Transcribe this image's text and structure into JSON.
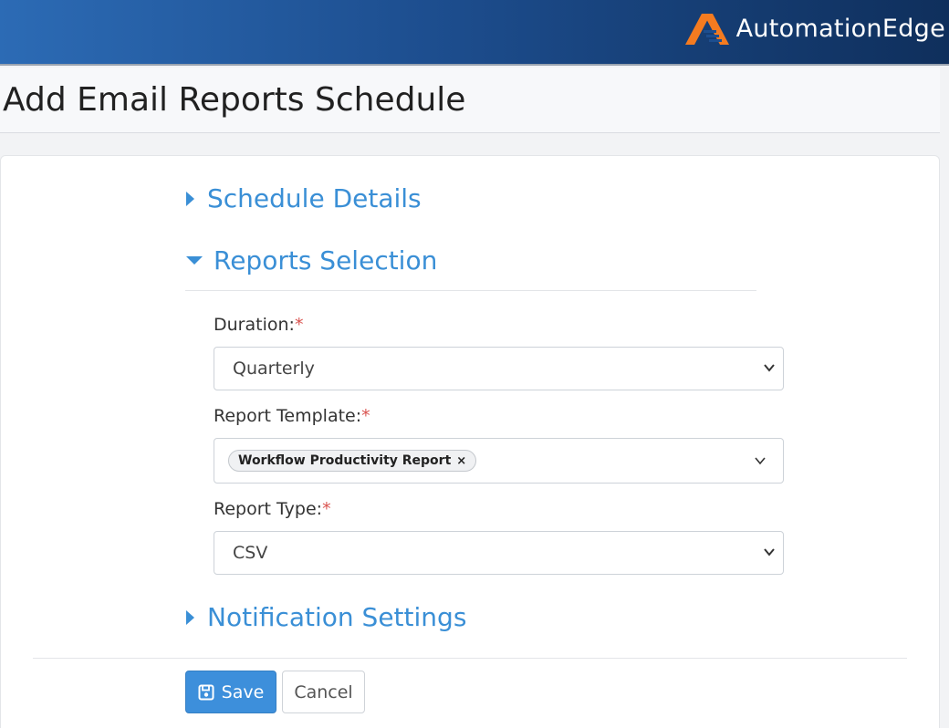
{
  "header": {
    "brand_name": "AutomationEdge",
    "logo_icon": "automationedge-logo-icon"
  },
  "page": {
    "title": "Add Email Reports Schedule"
  },
  "sections": {
    "schedule_details": {
      "label": "Schedule Details",
      "expanded": false
    },
    "reports_selection": {
      "label": "Reports Selection",
      "expanded": true
    },
    "notification_settings": {
      "label": "Notification Settings",
      "expanded": false
    }
  },
  "form": {
    "duration": {
      "label": "Duration:",
      "required_mark": "*",
      "value": "Quarterly"
    },
    "report_template": {
      "label": "Report Template:",
      "required_mark": "*",
      "selected_tag": "Workflow Productivity Report",
      "remove_glyph": "×"
    },
    "report_type": {
      "label": "Report Type:",
      "required_mark": "*",
      "value": "CSV"
    }
  },
  "actions": {
    "save_label": "Save",
    "cancel_label": "Cancel"
  },
  "colors": {
    "accent": "#3a8fd6",
    "primary_button": "#3d8fdb",
    "required": "#d9534f",
    "header_start": "#2c6bb5",
    "header_end": "#0f2f5c",
    "logo_orange": "#f47b20"
  }
}
